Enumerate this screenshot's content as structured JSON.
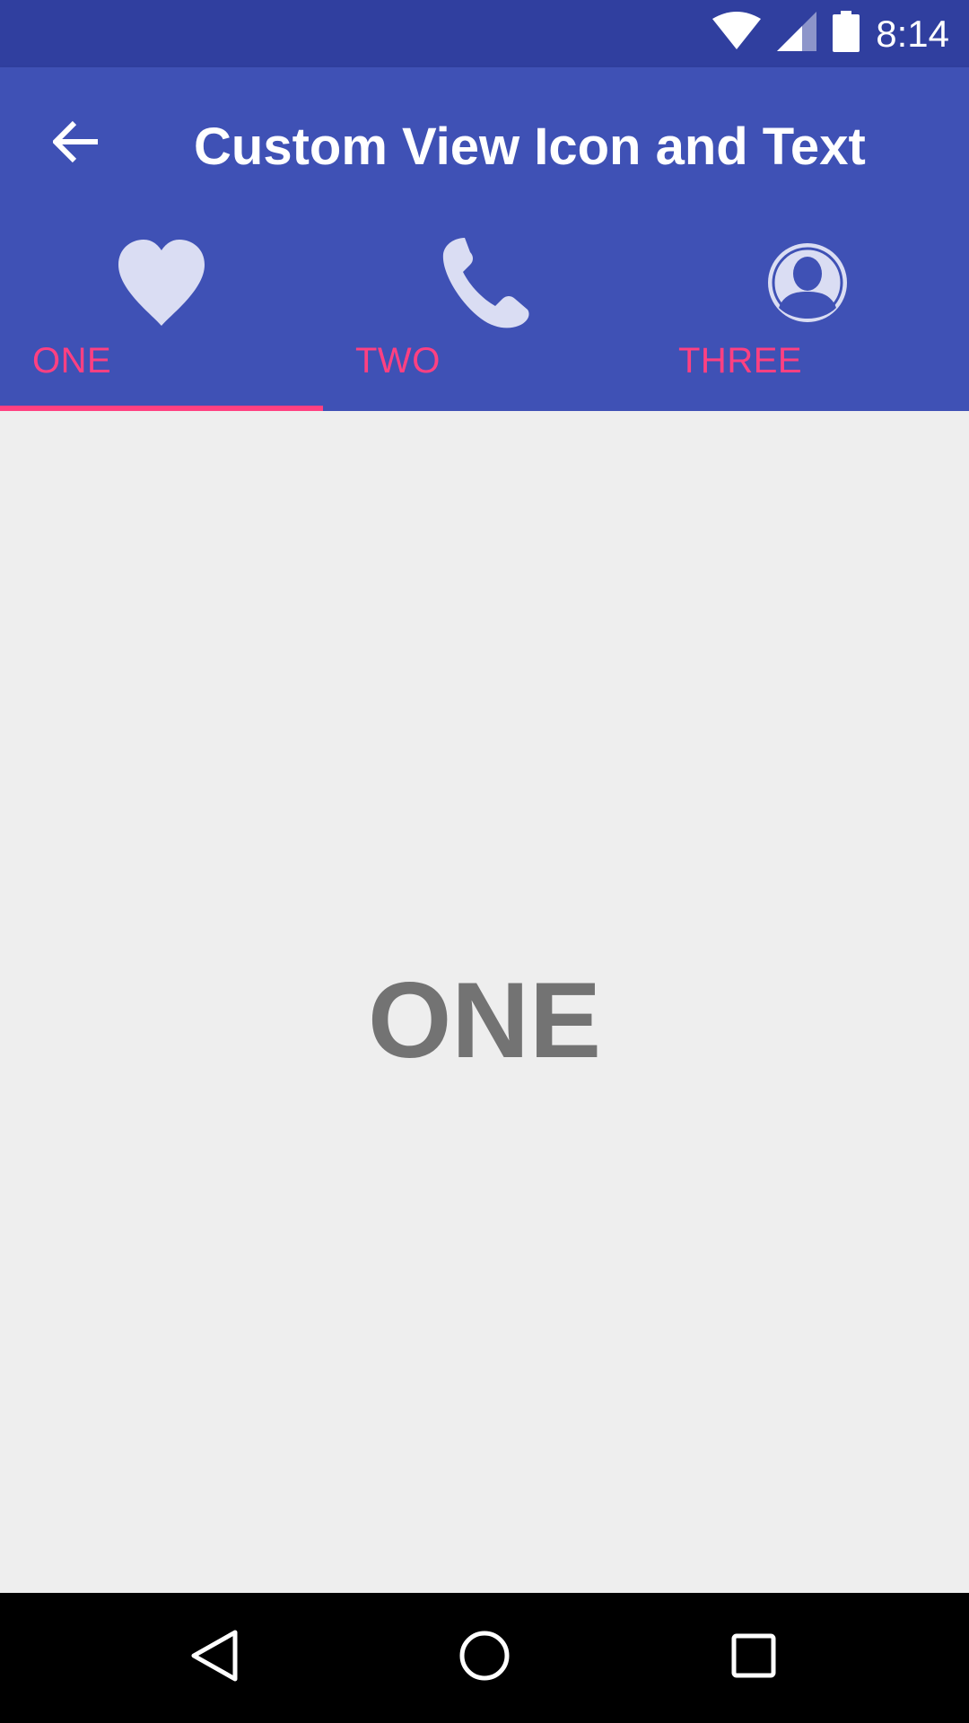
{
  "status_bar": {
    "time": "8:14",
    "icons": [
      "wifi-icon",
      "cell-signal-icon",
      "battery-icon"
    ]
  },
  "app_bar": {
    "title": "Custom View Icon and Text",
    "back_icon": "arrow-back-icon"
  },
  "tabs": [
    {
      "label": "ONE",
      "icon": "heart-icon",
      "selected": true
    },
    {
      "label": "TWO",
      "icon": "phone-icon",
      "selected": false
    },
    {
      "label": "THREE",
      "icon": "account-icon",
      "selected": false
    }
  ],
  "content": {
    "text": "ONE"
  },
  "nav_bar": {
    "icons": [
      "nav-back-icon",
      "nav-home-icon",
      "nav-recents-icon"
    ]
  },
  "colors": {
    "primary": "#3F51B5",
    "primary_dark": "#303F9F",
    "accent": "#FF4081",
    "tab_icon": "#DADDF3",
    "background": "#EEEEEE",
    "content_text": "#737373"
  }
}
